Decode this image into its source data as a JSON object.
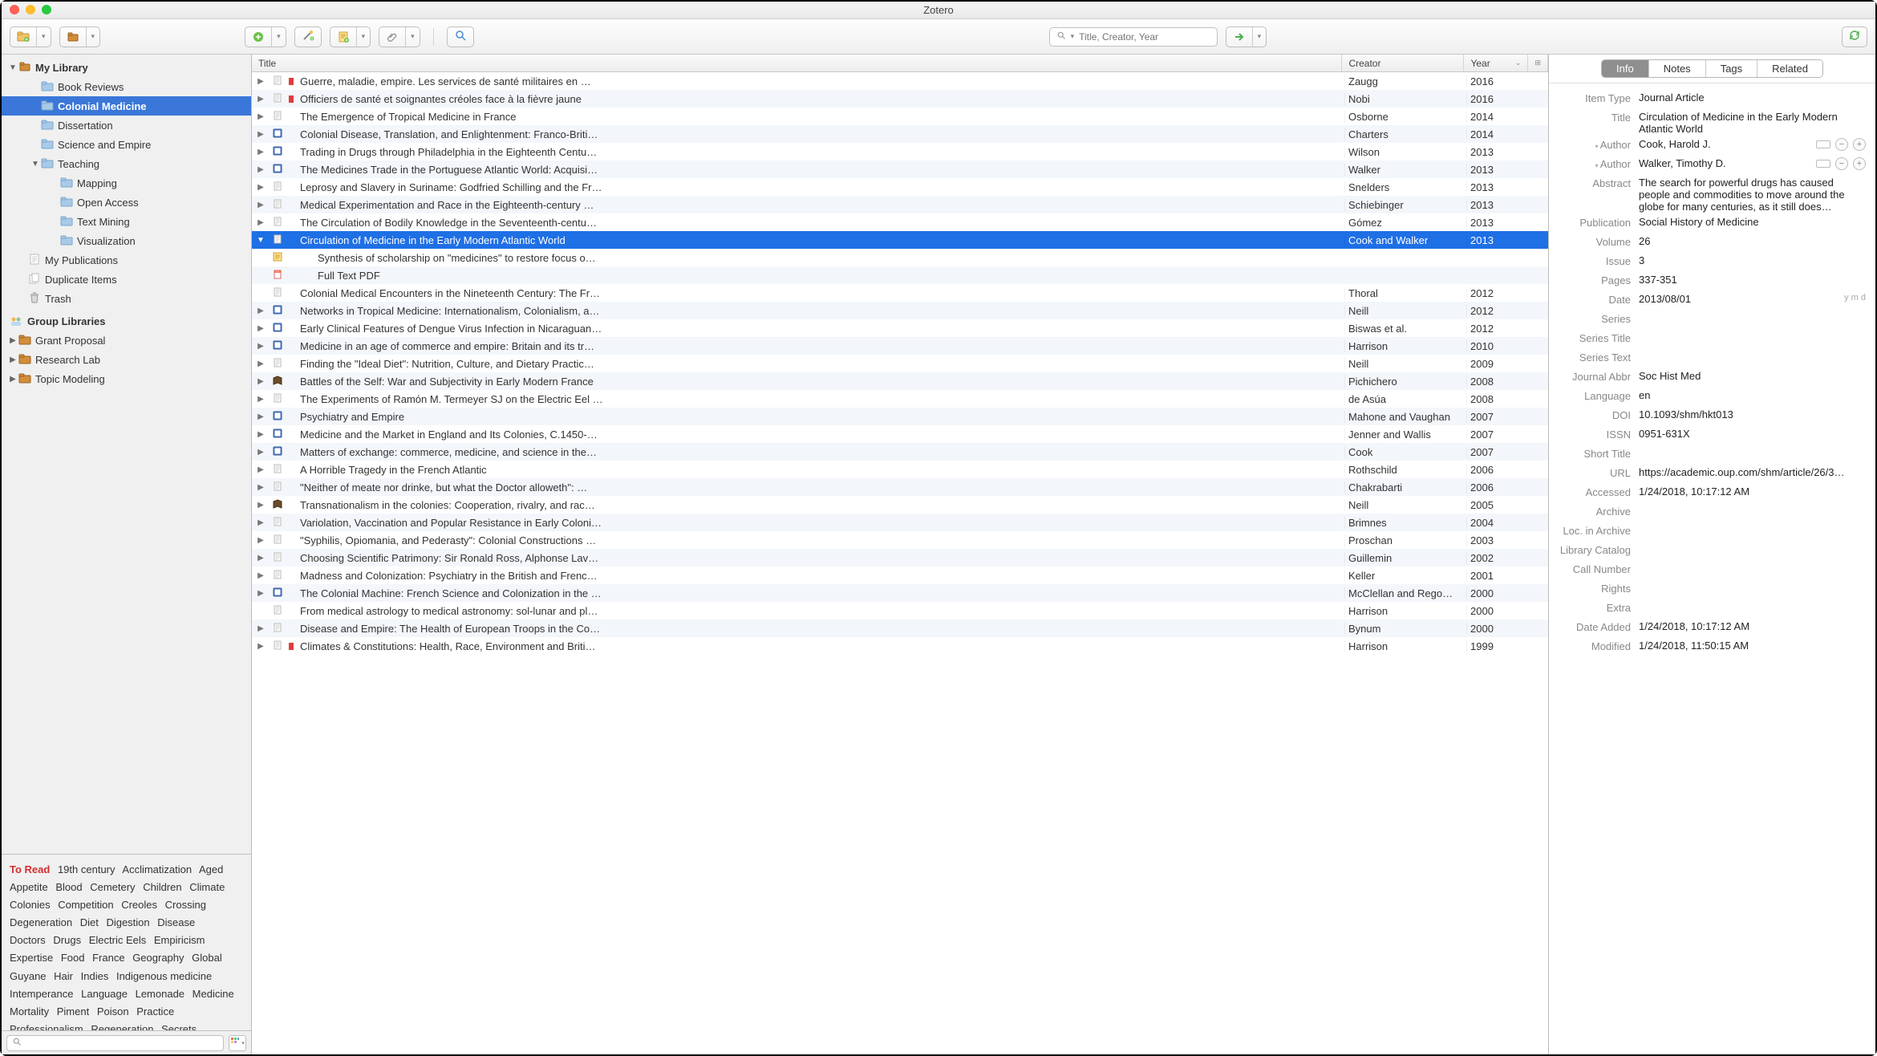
{
  "app_title": "Zotero",
  "search_placeholder": "Title, Creator, Year",
  "sidebar": {
    "my_library": "My Library",
    "items": [
      {
        "label": "Book Reviews"
      },
      {
        "label": "Colonial Medicine",
        "selected": true
      },
      {
        "label": "Dissertation"
      },
      {
        "label": "Science and Empire"
      },
      {
        "label": "Teaching",
        "expandable": true,
        "children": [
          {
            "label": "Mapping"
          },
          {
            "label": "Open Access"
          },
          {
            "label": "Text Mining"
          },
          {
            "label": "Visualization"
          }
        ]
      },
      {
        "label": "My Publications",
        "icon": "doc"
      },
      {
        "label": "Duplicate Items",
        "icon": "dup"
      },
      {
        "label": "Trash",
        "icon": "trash"
      }
    ],
    "group_header": "Group Libraries",
    "groups": [
      {
        "label": "Grant Proposal"
      },
      {
        "label": "Research Lab"
      },
      {
        "label": "Topic Modeling"
      }
    ]
  },
  "tags": [
    "To Read",
    "19th century",
    "Acclimatization",
    "Aged",
    "Appetite",
    "Blood",
    "Cemetery",
    "Children",
    "Climate",
    "Colonies",
    "Competition",
    "Creoles",
    "Crossing",
    "Degeneration",
    "Diet",
    "Digestion",
    "Disease",
    "Doctors",
    "Drugs",
    "Electric Eels",
    "Empiricism",
    "Expertise",
    "Food",
    "France",
    "Geography",
    "Global",
    "Guyane",
    "Hair",
    "Indies",
    "Indigenous medicine",
    "Intemperance",
    "Language",
    "Lemonade",
    "Medicine",
    "Mortality",
    "Piment",
    "Poison",
    "Practice",
    "Professionalism",
    "Regeneration",
    "Secrets"
  ],
  "columns": {
    "title": "Title",
    "creator": "Creator",
    "year": "Year"
  },
  "items": [
    {
      "icon": "doc",
      "red": true,
      "title": "Guerre, maladie, empire. Les services de santé militaires en …",
      "creator": "Zaugg",
      "year": "2016",
      "expand": true
    },
    {
      "icon": "doc",
      "red": true,
      "title": "Officiers de santé et soignantes créoles face à la fièvre jaune",
      "creator": "Nobi",
      "year": "2016",
      "expand": true
    },
    {
      "icon": "doc",
      "title": "The Emergence of Tropical Medicine in France",
      "creator": "Osborne",
      "year": "2014",
      "expand": true
    },
    {
      "icon": "book",
      "title": "Colonial Disease, Translation, and Enlightenment: Franco-Briti…",
      "creator": "Charters",
      "year": "2014",
      "expand": true
    },
    {
      "icon": "book",
      "title": "Trading in Drugs through Philadelphia in the Eighteenth Centu…",
      "creator": "Wilson",
      "year": "2013",
      "expand": true
    },
    {
      "icon": "book",
      "title": "The Medicines Trade in the Portuguese Atlantic World: Acquisi…",
      "creator": "Walker",
      "year": "2013",
      "expand": true
    },
    {
      "icon": "doc",
      "title": "Leprosy and Slavery in Suriname: Godfried Schilling and the Fr…",
      "creator": "Snelders",
      "year": "2013",
      "expand": true
    },
    {
      "icon": "doc",
      "title": "Medical Experimentation and Race in the Eighteenth-century …",
      "creator": "Schiebinger",
      "year": "2013",
      "expand": true
    },
    {
      "icon": "doc",
      "title": "The Circulation of Bodily Knowledge in the Seventeenth-centu…",
      "creator": "Gómez",
      "year": "2013",
      "expand": true
    },
    {
      "icon": "doc",
      "title": "Circulation of Medicine in the Early Modern Atlantic World",
      "creator": "Cook and Walker",
      "year": "2013",
      "selected": true,
      "expanded": true
    },
    {
      "icon": "note",
      "title": "Synthesis of scholarship on \"medicines\" to restore focus o…",
      "creator": "",
      "year": "",
      "child": true
    },
    {
      "icon": "pdf",
      "title": "Full Text PDF",
      "creator": "",
      "year": "",
      "child": true
    },
    {
      "icon": "doc",
      "title": "Colonial Medical Encounters in the Nineteenth Century: The Fr…",
      "creator": "Thoral",
      "year": "2012"
    },
    {
      "icon": "book",
      "title": "Networks in Tropical Medicine: Internationalism, Colonialism, a…",
      "creator": "Neill",
      "year": "2012",
      "expand": true
    },
    {
      "icon": "book",
      "title": "Early Clinical Features of Dengue Virus Infection in Nicaraguan…",
      "creator": "Biswas et al.",
      "year": "2012",
      "expand": true
    },
    {
      "icon": "book",
      "title": "Medicine in an age of commerce and empire: Britain and its tr…",
      "creator": "Harrison",
      "year": "2010",
      "expand": true
    },
    {
      "icon": "doc",
      "title": "Finding the \"Ideal Diet\": Nutrition, Culture, and Dietary Practic…",
      "creator": "Neill",
      "year": "2009",
      "expand": true
    },
    {
      "icon": "bookd",
      "title": "Battles of the Self: War and Subjectivity in Early Modern France",
      "creator": "Pichichero",
      "year": "2008",
      "expand": true
    },
    {
      "icon": "doc",
      "title": "The Experiments of Ramón M. Termeyer SJ on the Electric Eel …",
      "creator": "de Asúa",
      "year": "2008",
      "expand": true
    },
    {
      "icon": "book",
      "title": "Psychiatry and Empire",
      "creator": "Mahone and Vaughan",
      "year": "2007",
      "expand": true
    },
    {
      "icon": "book",
      "title": "Medicine and the Market in England and Its Colonies, C.1450-…",
      "creator": "Jenner and Wallis",
      "year": "2007",
      "expand": true
    },
    {
      "icon": "book",
      "title": "Matters of exchange: commerce, medicine, and science in the…",
      "creator": "Cook",
      "year": "2007",
      "expand": true
    },
    {
      "icon": "doc",
      "title": "A Horrible Tragedy in the French Atlantic",
      "creator": "Rothschild",
      "year": "2006",
      "expand": true
    },
    {
      "icon": "doc",
      "title": "\"Neither of meate nor drinke, but what the Doctor alloweth\": …",
      "creator": "Chakrabarti",
      "year": "2006",
      "expand": true
    },
    {
      "icon": "bookd",
      "title": "Transnationalism in the colonies: Cooperation, rivalry, and rac…",
      "creator": "Neill",
      "year": "2005",
      "expand": true
    },
    {
      "icon": "doc",
      "title": "Variolation, Vaccination and Popular Resistance in Early Coloni…",
      "creator": "Brimnes",
      "year": "2004",
      "expand": true
    },
    {
      "icon": "doc",
      "title": "\"Syphilis, Opiomania, and Pederasty\": Colonial Constructions …",
      "creator": "Proschan",
      "year": "2003",
      "expand": true
    },
    {
      "icon": "doc",
      "title": "Choosing Scientific Patrimony: Sir Ronald Ross, Alphonse Lav…",
      "creator": "Guillemin",
      "year": "2002",
      "expand": true
    },
    {
      "icon": "doc",
      "title": "Madness and Colonization: Psychiatry in the British and Frenc…",
      "creator": "Keller",
      "year": "2001",
      "expand": true
    },
    {
      "icon": "book",
      "title": "The Colonial Machine: French Science and Colonization in the …",
      "creator": "McClellan and Rego…",
      "year": "2000",
      "expand": true
    },
    {
      "icon": "doc",
      "title": "From medical astrology to medical astronomy: sol-lunar and pl…",
      "creator": "Harrison",
      "year": "2000"
    },
    {
      "icon": "doc",
      "title": "Disease and Empire: The Health of European Troops in the Co…",
      "creator": "Bynum",
      "year": "2000",
      "expand": true
    },
    {
      "icon": "doc",
      "red": true,
      "title": "Climates & Constitutions: Health, Race, Environment and Briti…",
      "creator": "Harrison",
      "year": "1999",
      "expand": true
    }
  ],
  "tabs": {
    "info": "Info",
    "notes": "Notes",
    "tags": "Tags",
    "related": "Related"
  },
  "info": {
    "item_type_label": "Item Type",
    "item_type": "Journal Article",
    "title_label": "Title",
    "title": "Circulation of Medicine in the Early Modern Atlantic World",
    "author_label": "Author",
    "author1": "Cook, Harold J.",
    "author2": "Walker, Timothy D.",
    "abstract_label": "Abstract",
    "abstract": "The search for powerful drugs has caused people and commodities to move around the globe for many centuries, as it still does…",
    "publication_label": "Publication",
    "publication": "Social History of Medicine",
    "volume_label": "Volume",
    "volume": "26",
    "issue_label": "Issue",
    "issue": "3",
    "pages_label": "Pages",
    "pages": "337-351",
    "date_label": "Date",
    "date": "2013/08/01",
    "date_hint": "y m d",
    "series_label": "Series",
    "series_title_label": "Series Title",
    "series_text_label": "Series Text",
    "journal_abbr_label": "Journal Abbr",
    "journal_abbr": "Soc Hist Med",
    "language_label": "Language",
    "language": "en",
    "doi_label": "DOI",
    "doi": "10.1093/shm/hkt013",
    "issn_label": "ISSN",
    "issn": "0951-631X",
    "short_title_label": "Short Title",
    "url_label": "URL",
    "url": "https://academic.oup.com/shm/article/26/3…",
    "accessed_label": "Accessed",
    "accessed": "1/24/2018, 10:17:12 AM",
    "archive_label": "Archive",
    "loc_label": "Loc. in Archive",
    "catalog_label": "Library Catalog",
    "call_label": "Call Number",
    "rights_label": "Rights",
    "extra_label": "Extra",
    "added_label": "Date Added",
    "added": "1/24/2018, 10:17:12 AM",
    "modified_label": "Modified",
    "modified": "1/24/2018, 11:50:15 AM"
  }
}
